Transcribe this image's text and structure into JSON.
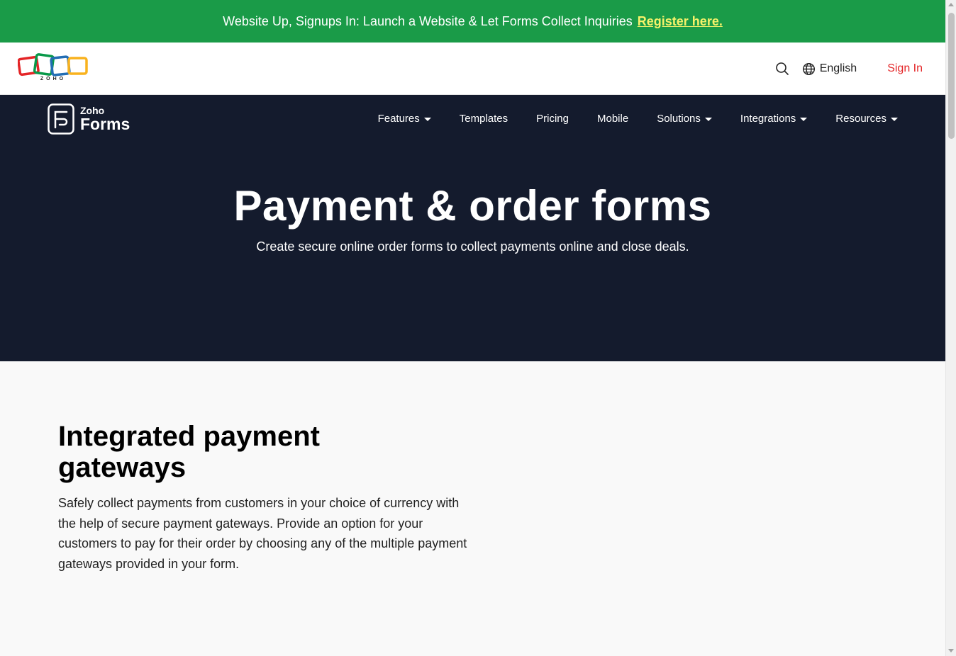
{
  "announcement": {
    "text": "Website Up, Signups In: Launch a Website & Let Forms Collect Inquiries",
    "link_label": "Register here.",
    "background": "#1a9b48",
    "link_color": "#f7f26a"
  },
  "zoho_header": {
    "logo_text": "ZOHO",
    "search_icon": "search-icon",
    "language_label": "English",
    "language_icon": "globe-icon",
    "signin_label": "Sign In",
    "signin_color": "#e42527"
  },
  "product_nav": {
    "logo_small": "Zoho",
    "logo_large": "Forms",
    "items": [
      {
        "label": "Features",
        "dropdown": true
      },
      {
        "label": "Templates",
        "dropdown": false
      },
      {
        "label": "Pricing",
        "dropdown": false
      },
      {
        "label": "Mobile",
        "dropdown": false
      },
      {
        "label": "Solutions",
        "dropdown": true
      },
      {
        "label": "Integrations",
        "dropdown": true
      },
      {
        "label": "Resources",
        "dropdown": true
      }
    ],
    "background": "#141b2d"
  },
  "hero": {
    "title": "Payment & order forms",
    "subtitle": "Create secure online order forms to collect payments online and close deals."
  },
  "section": {
    "title": "Integrated payment gateways",
    "body": "Safely collect payments from customers in your choice of currency with the help of secure payment gateways. Provide an option for your customers to pay for their order by choosing any of the multiple payment gateways provided in your form."
  }
}
